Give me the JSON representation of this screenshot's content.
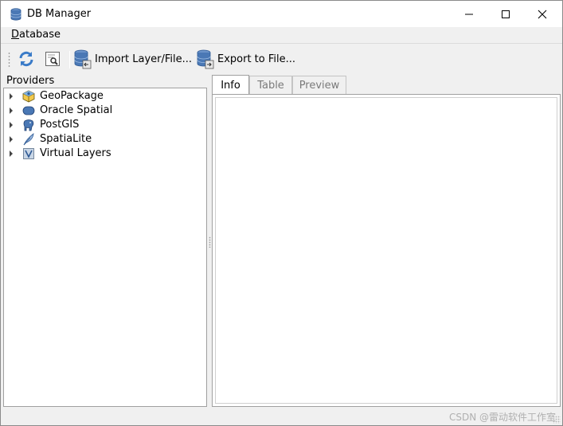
{
  "window": {
    "title": "DB Manager",
    "icon": "database-icon"
  },
  "menubar": {
    "items": [
      {
        "label": "Database",
        "mnemonic": "D"
      }
    ]
  },
  "toolbar": {
    "refresh_icon": "refresh-icon",
    "sql_window_icon": "sql-window-icon",
    "import_label": "Import Layer/File...",
    "export_label": "Export to File..."
  },
  "providers": {
    "title": "Providers",
    "items": [
      {
        "label": "GeoPackage",
        "icon": "geopackage-icon"
      },
      {
        "label": "Oracle Spatial",
        "icon": "oracle-spatial-icon"
      },
      {
        "label": "PostGIS",
        "icon": "postgis-elephant-icon"
      },
      {
        "label": "SpatiaLite",
        "icon": "spatialite-feather-icon"
      },
      {
        "label": "Virtual Layers",
        "icon": "virtual-layers-icon"
      }
    ]
  },
  "tabs": [
    {
      "label": "Info",
      "active": true
    },
    {
      "label": "Table",
      "active": false
    },
    {
      "label": "Preview",
      "active": false
    }
  ],
  "statusbar": {
    "watermark": "CSDN @雷动软件工作室"
  },
  "colors": {
    "window_bg": "#f0f0f0",
    "panel_bg": "#ffffff",
    "border": "#a0a0a0",
    "db_blue": "#4a78b5"
  }
}
